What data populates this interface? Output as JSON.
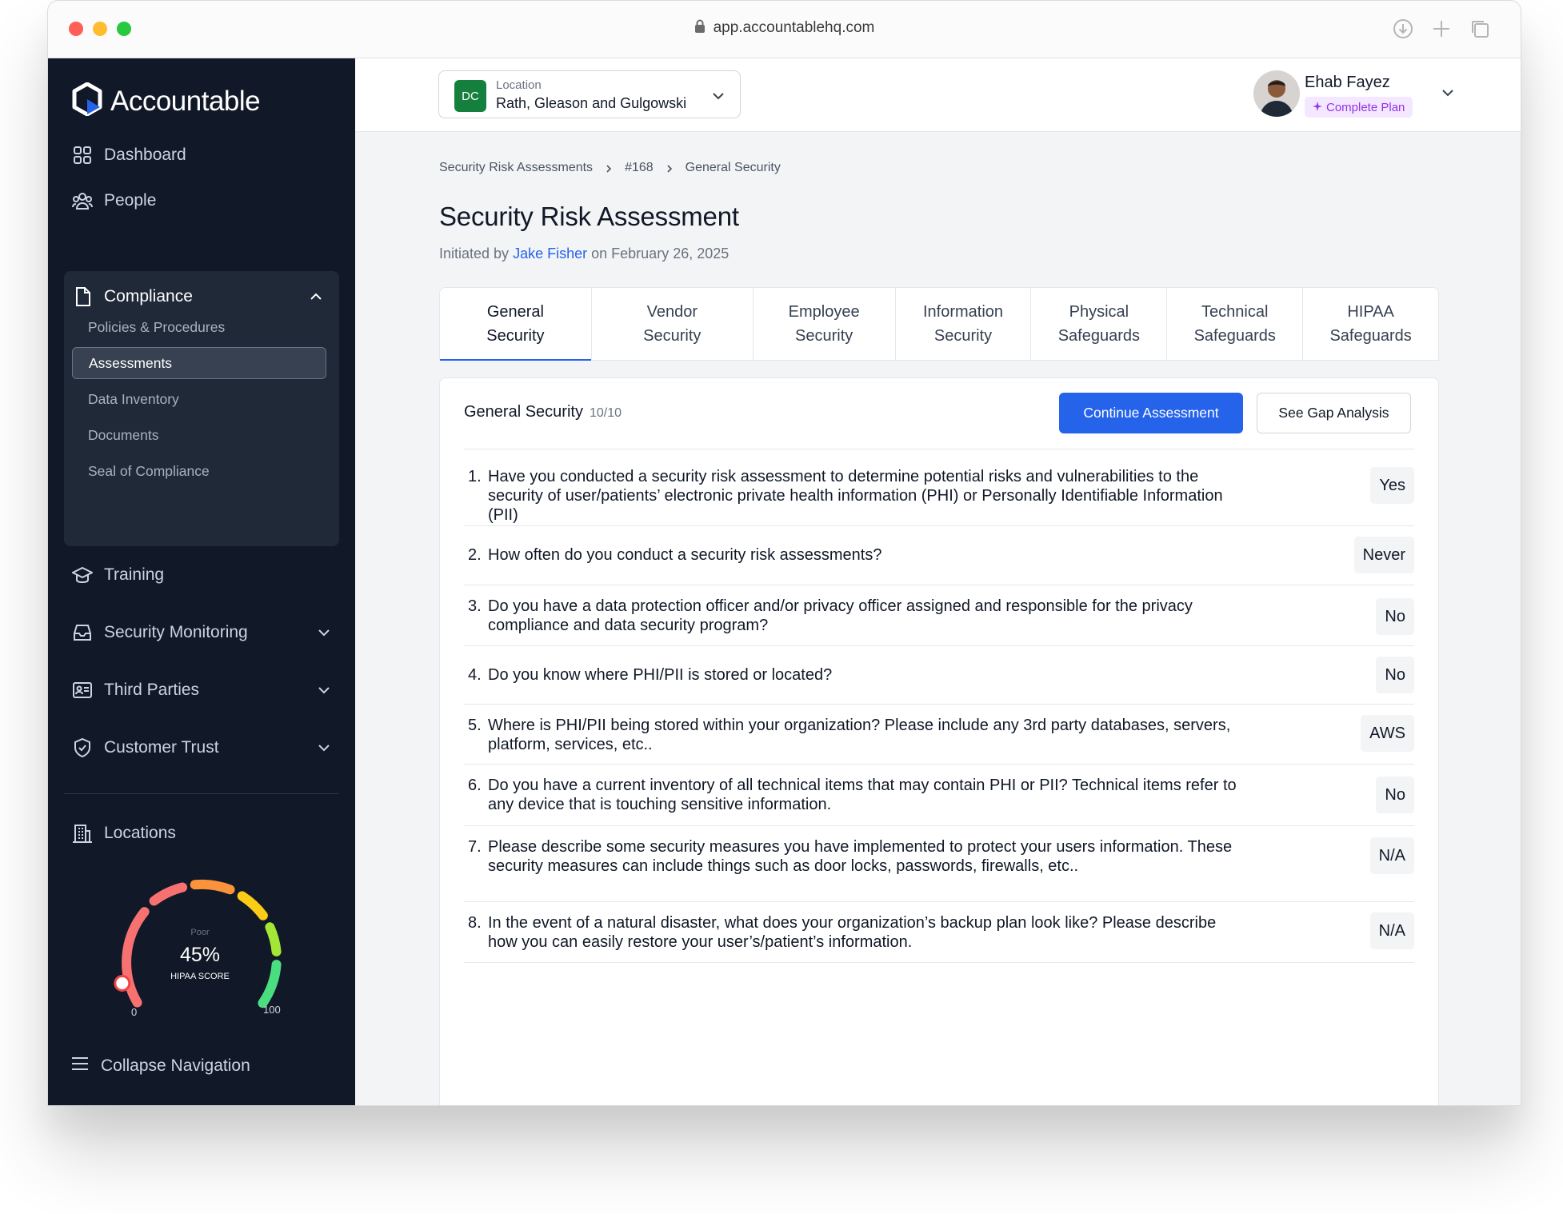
{
  "browser": {
    "url": "app.accountablehq.com"
  },
  "sidebar": {
    "brand": "Accountable",
    "items": [
      {
        "label": "Dashboard",
        "icon": "grid-icon"
      },
      {
        "label": "People",
        "icon": "people-icon"
      },
      {
        "label": "Compliance",
        "icon": "document-icon",
        "expanded": true
      },
      {
        "label": "Training",
        "icon": "graduation-cap-icon"
      },
      {
        "label": "Security Monitoring",
        "icon": "inbox-icon"
      },
      {
        "label": "Third Parties",
        "icon": "id-card-icon"
      },
      {
        "label": "Customer Trust",
        "icon": "shield-check-icon"
      },
      {
        "label": "Locations",
        "icon": "building-icon"
      }
    ],
    "compliance_sub": [
      {
        "label": "Policies & Procedures"
      },
      {
        "label": "Assessments",
        "active": true
      },
      {
        "label": "Data Inventory"
      },
      {
        "label": "Documents"
      },
      {
        "label": "Seal of Compliance"
      }
    ],
    "gauge": {
      "status": "Poor",
      "value": "45%",
      "label": "HIPAA SCORE",
      "min": "0",
      "max": "100",
      "score": 45
    },
    "collapse_label": "Collapse Navigation"
  },
  "topbar": {
    "location_label": "Location",
    "location_badge": "DC",
    "location_value": "Rath, Gleason and Gulgowski",
    "user_name": "Ehab Fayez",
    "plan_badge": "Complete Plan"
  },
  "breadcrumb": [
    "Security Risk Assessments",
    "#168",
    "General Security"
  ],
  "page": {
    "title": "Security Risk Assessment",
    "initiated_prefix": "Initiated by",
    "initiated_by": "Jake Fisher",
    "initiated_suffix": "on February 26, 2025"
  },
  "tabs": [
    {
      "label": "General Security",
      "active": true
    },
    {
      "label": "Vendor Security"
    },
    {
      "label": "Employee Security"
    },
    {
      "label": "Information Security"
    },
    {
      "label": "Physical Safeguards"
    },
    {
      "label": "Technical Safeguards"
    },
    {
      "label": "HIPAA Safeguards"
    }
  ],
  "card": {
    "title": "General Security",
    "count": "10/10",
    "continue_label": "Continue Assessment",
    "gap_label": "See Gap Analysis"
  },
  "questions": [
    {
      "num": "1.",
      "text": "Have you conducted a security risk assessment to determine potential risks and vulnerabilities to the security of user/patients’ electronic private health information (PHI) or Personally Identifiable Information (PII)",
      "answer": "Yes"
    },
    {
      "num": "2.",
      "text": "How often do you conduct a security risk assessments?",
      "answer": "Never"
    },
    {
      "num": "3.",
      "text": "Do you have a data protection officer and/or privacy officer assigned and responsible for the privacy compliance and data security program?",
      "answer": "No"
    },
    {
      "num": "4.",
      "text": "Do you know where PHI/PII is stored or located?",
      "answer": "No"
    },
    {
      "num": "5.",
      "text": "Where is PHI/PII being stored within your organization? Please include any 3rd party databases, servers, platform, services, etc..",
      "answer": "AWS"
    },
    {
      "num": "6.",
      "text": "Do you have a current inventory of all technical items that may contain PHI or PII? Technical items refer to any device that is touching sensitive information.",
      "answer": "No"
    },
    {
      "num": "7.",
      "text": "Please describe some security measures you have implemented to protect your users information. These security measures can include things such as door locks, passwords, firewalls, etc..",
      "answer": "N/A"
    },
    {
      "num": "8.",
      "text": "In the event of a natural disaster, what does your organization’s backup plan look like? Please describe how you can easily restore your user’s/patient’s information.",
      "answer": "N/A"
    }
  ]
}
